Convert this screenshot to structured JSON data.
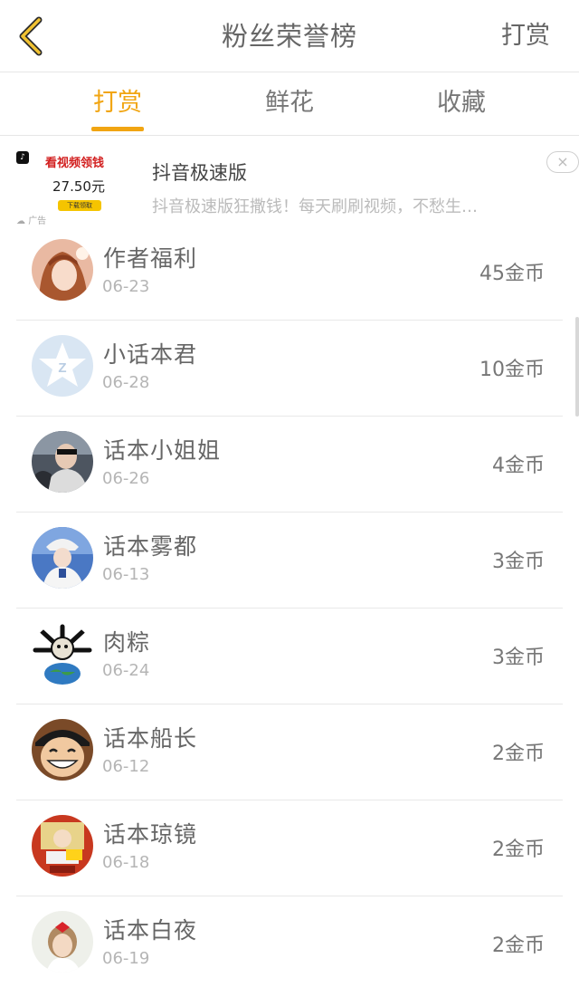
{
  "header": {
    "title": "粉丝荣誉榜",
    "action_label": "打赏",
    "back_icon": "chevron-left-icon",
    "accent_color": "#f1a512"
  },
  "tabs": [
    {
      "label": "打赏",
      "active": true
    },
    {
      "label": "鲜花",
      "active": false
    },
    {
      "label": "收藏",
      "active": false
    }
  ],
  "ad": {
    "thumb_headline": "看视频领钱",
    "thumb_amount": "27.50元",
    "thumb_button": "下载领取",
    "tag": "广告",
    "title": "抖音极速版",
    "description": "抖音极速版狂撒钱！每天刷刷视频，不愁生…",
    "close_label": "×"
  },
  "rank_list": [
    {
      "name": "作者福利",
      "date": "06-23",
      "coins": "45金币"
    },
    {
      "name": "小话本君",
      "date": "06-28",
      "coins": "10金币"
    },
    {
      "name": "话本小姐姐",
      "date": "06-26",
      "coins": "4金币"
    },
    {
      "name": "话本雾都",
      "date": "06-13",
      "coins": "3金币"
    },
    {
      "name": "肉粽",
      "date": "06-24",
      "coins": "3金币"
    },
    {
      "name": "话本船长",
      "date": "06-12",
      "coins": "2金币"
    },
    {
      "name": "话本琼镜",
      "date": "06-18",
      "coins": "2金币"
    },
    {
      "name": "话本白夜",
      "date": "06-19",
      "coins": "2金币"
    }
  ]
}
